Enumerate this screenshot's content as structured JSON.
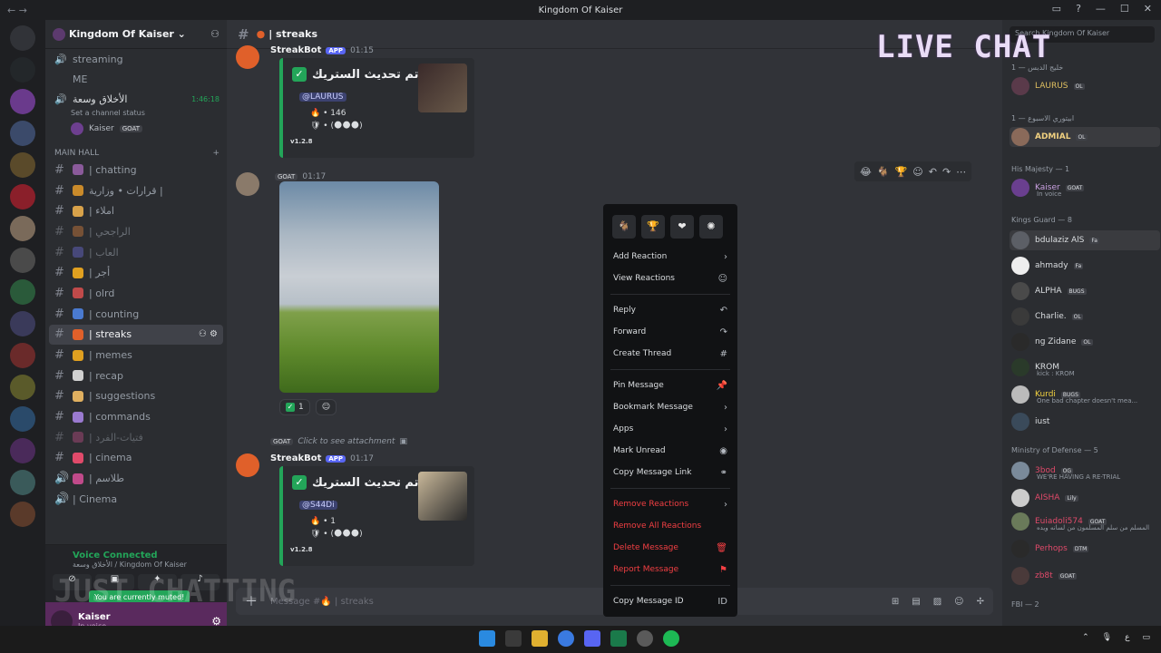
{
  "window": {
    "title": "Kingdom Of Kaiser"
  },
  "server": {
    "name": "Kingdom Of Kaiser"
  },
  "voice_channels": [
    {
      "name": "streaming"
    },
    {
      "name": "ME"
    },
    {
      "name": "الأخلاق وسعة",
      "time": "1:46:18",
      "status": "Set a channel status"
    }
  ],
  "voice_user": {
    "name": "Kaiser",
    "tag": "GOAT"
  },
  "category": {
    "name": "MAIN HALL"
  },
  "channels": [
    {
      "name": "| chatting"
    },
    {
      "name": "قرارات • وزارية |"
    },
    {
      "name": "| املاء"
    },
    {
      "name": "| الراجحي"
    },
    {
      "name": "| العاب"
    },
    {
      "name": "| أجر"
    },
    {
      "name": "| olrd"
    },
    {
      "name": "| counting"
    },
    {
      "name": "| streaks"
    },
    {
      "name": "| memes"
    },
    {
      "name": "| recap"
    },
    {
      "name": "| suggestions"
    },
    {
      "name": "| commands"
    },
    {
      "name": "| فتيات-الفرد"
    },
    {
      "name": "| cinema"
    },
    {
      "name": "| طلاسم"
    },
    {
      "name": "| Cinema"
    }
  ],
  "voice_bar": {
    "connected": "Voice Connected",
    "sub": "الأخلاق وسعة / Kingdom Of Kaiser",
    "muted_tip": "You are currently muted!"
  },
  "user_panel": {
    "name": "Kaiser",
    "status": "In voice"
  },
  "channel_header": {
    "name": "| streaks"
  },
  "messages": {
    "m1": {
      "author": "StreakBot",
      "app": "APP",
      "time": "01:15",
      "title": "تم تحديث الستريك •",
      "mention": "@LAURUS",
      "line1": "🔥 • 146",
      "line2": "🛡 • (🌑🌑🌑)",
      "version": "v1.2.8"
    },
    "m2": {
      "author": "",
      "tag": "GOAT",
      "time": "01:17",
      "reaction_count": "1"
    },
    "m3": {
      "reply_tag": "GOAT",
      "reply_text": "Click to see attachment",
      "author": "StreakBot",
      "app": "APP",
      "time": "01:17",
      "title": "تم تحديث الستريك •",
      "mention": "@S44Di",
      "line1": "🔥 • 1",
      "line2": "🛡 • (🌑🌑🌑)",
      "version": "v1.2.8"
    }
  },
  "composer": {
    "placeholder": "Message #🔥 | streaks"
  },
  "context_menu": {
    "add_reaction": "Add Reaction",
    "view_reactions": "View Reactions",
    "reply": "Reply",
    "forward": "Forward",
    "create_thread": "Create Thread",
    "pin": "Pin Message",
    "bookmark": "Bookmark Message",
    "apps": "Apps",
    "mark_unread": "Mark Unread",
    "copy_link": "Copy Message Link",
    "remove_reactions": "Remove Reactions",
    "remove_all_reactions": "Remove All Reactions",
    "delete": "Delete Message",
    "report": "Report Message",
    "copy_id": "Copy Message ID"
  },
  "members": {
    "search_placeholder": "Search Kingdom Of Kaiser",
    "groups": [
      {
        "label": "خليج الدبس — 1"
      },
      {
        "label": "ابيتوري الاسبوع — 1"
      },
      {
        "label": "His Majesty — 1"
      },
      {
        "label": "Kings Guard — 8"
      },
      {
        "label": "Ministry of Defense — 5"
      },
      {
        "label": "FBI — 2"
      }
    ],
    "rows": [
      {
        "name": "LAURUS",
        "tag": "OL"
      },
      {
        "name": "ADMIAL",
        "tag": "OL"
      },
      {
        "name": "Kaiser",
        "tag": "GOAT",
        "sub": "In voice"
      },
      {
        "name": "bdulaziz AlS",
        "tag": "Fa"
      },
      {
        "name": "ahmady",
        "tag": "Fa"
      },
      {
        "name": "ALPHA",
        "tag": "BUGS"
      },
      {
        "name": "Charlie.",
        "tag": "OL"
      },
      {
        "name": "ng Zidane",
        "tag": "OL"
      },
      {
        "name": "KROM",
        "tag": "",
        "sub": "kick : KROM"
      },
      {
        "name": "Kurdi",
        "tag": "BUGS",
        "sub": "One bad chapter doesn't mea..."
      },
      {
        "name": "iust",
        "tag": ""
      },
      {
        "name": "3bod",
        "tag": "OG",
        "sub": "WE'RE HAVING A RE-TRIAL"
      },
      {
        "name": "AISHA",
        "tag": "Lily"
      },
      {
        "name": "Euiadoli574",
        "tag": "GOAT",
        "sub": "المسلم من سلم المسلمون من لسانه ويده"
      },
      {
        "name": "Perhops",
        "tag": "DTM"
      },
      {
        "name": "zb8t",
        "tag": "GOAT"
      }
    ]
  },
  "overlay": {
    "live": "LIVE CHAT",
    "just": "JUST CHATTING"
  },
  "taskbar": {
    "lang": "ع"
  },
  "colors": {
    "accent": "#5865f2",
    "green": "#23a559",
    "danger": "#f23f43"
  }
}
